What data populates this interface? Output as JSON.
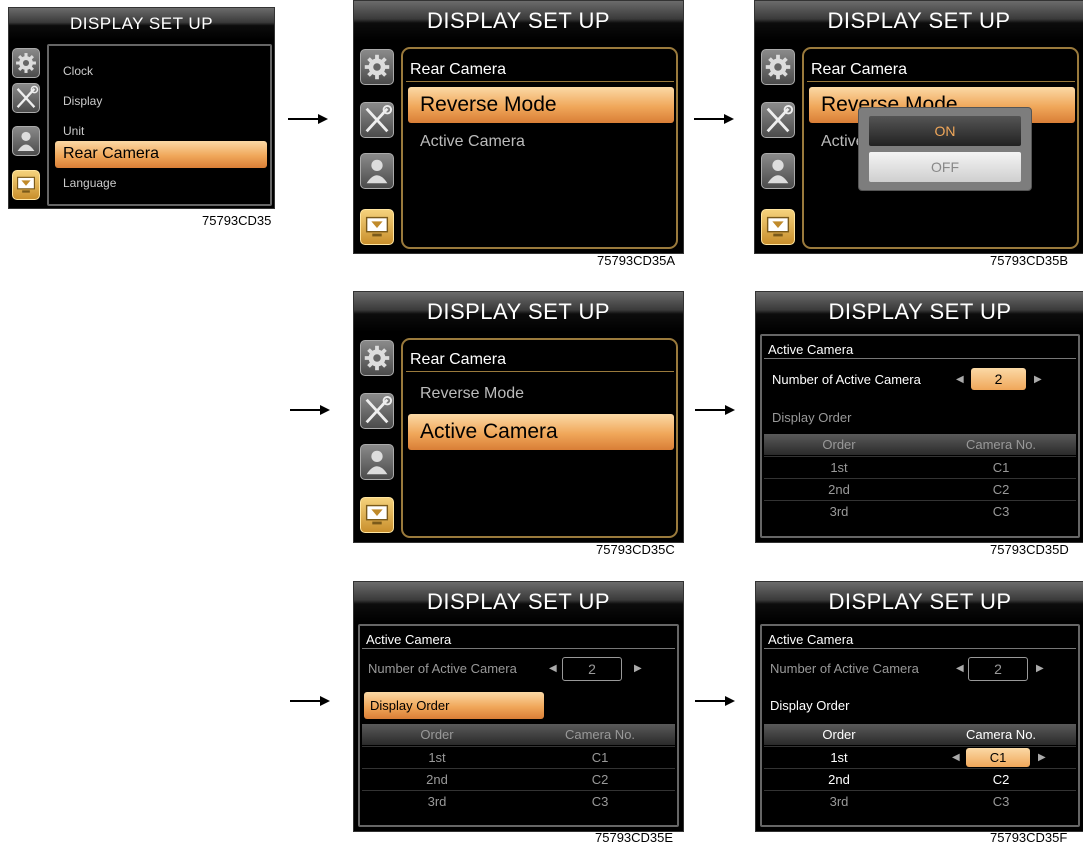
{
  "screens": {
    "A0": {
      "title": "DISPLAY SET UP",
      "menu": [
        "Clock",
        "Display",
        "Unit",
        "Rear Camera",
        "Language"
      ],
      "caption": "75793CD35"
    },
    "A": {
      "title": "DISPLAY SET UP",
      "header": "Rear Camera",
      "items": [
        "Reverse Mode",
        "Active Camera"
      ],
      "caption": "75793CD35A"
    },
    "B": {
      "title": "DISPLAY SET UP",
      "header": "Rear Camera",
      "item1_partial": "Reverse Mode",
      "item2_partial": "Active",
      "popup_on": "ON",
      "popup_off": "OFF",
      "caption": "75793CD35B"
    },
    "C": {
      "title": "DISPLAY SET UP",
      "header": "Rear Camera",
      "items": [
        "Reverse Mode",
        "Active Camera"
      ],
      "caption": "75793CD35C"
    },
    "D": {
      "title": "DISPLAY SET UP",
      "header": "Active Camera",
      "num_label": "Number of Active Camera",
      "num_value": "2",
      "order_label": "Display Order",
      "col_order": "Order",
      "col_camera": "Camera No.",
      "rows": [
        [
          "1st",
          "C1"
        ],
        [
          "2nd",
          "C2"
        ],
        [
          "3rd",
          "C3"
        ]
      ],
      "caption": "75793CD35D"
    },
    "E": {
      "title": "DISPLAY SET UP",
      "header": "Active Camera",
      "num_label": "Number of Active Camera",
      "num_value": "2",
      "order_label": "Display Order",
      "col_order": "Order",
      "col_camera": "Camera No.",
      "rows": [
        [
          "1st",
          "C1"
        ],
        [
          "2nd",
          "C2"
        ],
        [
          "3rd",
          "C3"
        ]
      ],
      "caption": "75793CD35E"
    },
    "F": {
      "title": "DISPLAY SET UP",
      "header": "Active Camera",
      "num_label": "Number of Active Camera",
      "num_value": "2",
      "order_label": "Display Order",
      "col_order": "Order",
      "col_camera": "Camera No.",
      "rows": [
        [
          "1st",
          "C1"
        ],
        [
          "2nd",
          "C2"
        ],
        [
          "3rd",
          "C3"
        ]
      ],
      "caption": "75793CD35F"
    }
  },
  "colors": {
    "highlight": "#f0a75a",
    "frame": "#9a7a3c",
    "active_icon": "#e0b050"
  },
  "icons": [
    "gear-icon",
    "wrench-screwdriver-icon",
    "user-icon",
    "display-icon"
  ]
}
